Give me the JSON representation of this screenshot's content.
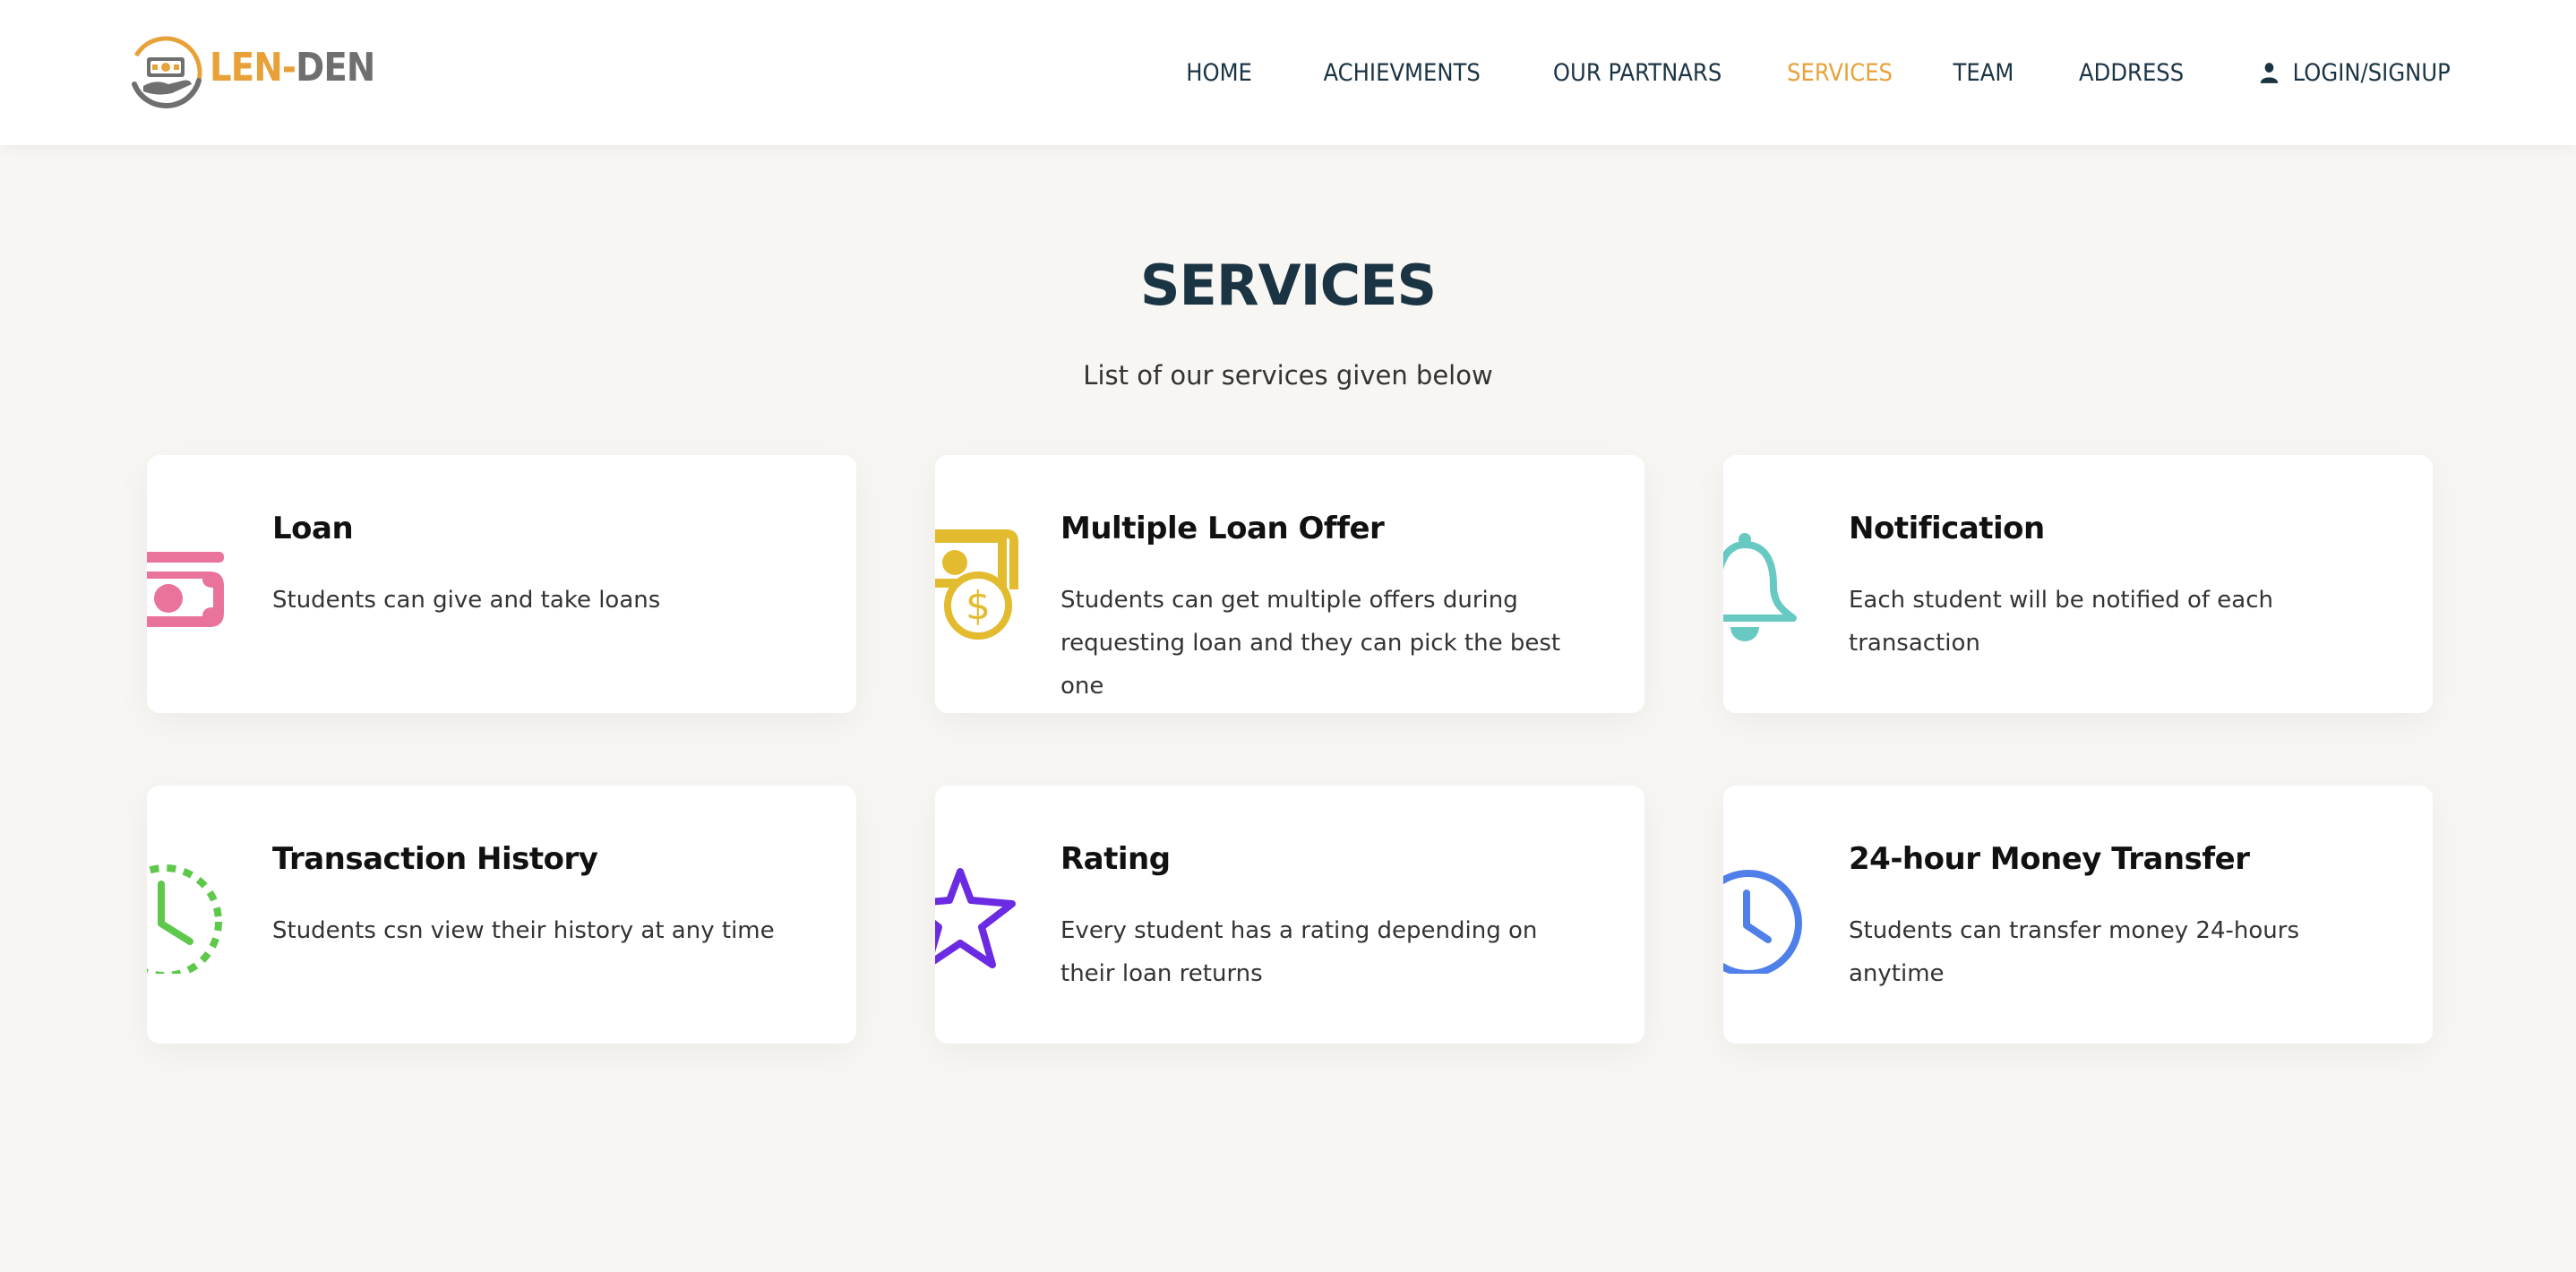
{
  "header": {
    "logo": {
      "part1": "LEN-",
      "part2": "DEN"
    },
    "nav": [
      {
        "label": "HOME"
      },
      {
        "label": "ACHIEVMENTS"
      },
      {
        "label": "OUR PARTNARS"
      },
      {
        "label": "SERVICES",
        "active": true
      },
      {
        "label": "TEAM"
      },
      {
        "label": "ADDRESS"
      }
    ],
    "login": {
      "label": "LOGIN/SIGNUP",
      "icon": "user-icon"
    }
  },
  "services": {
    "title": "SERVICES",
    "subtitle": "List of our services given below",
    "cards": [
      {
        "title": "Loan",
        "desc": "Students can give and take loans",
        "icon": "money-bill-icon",
        "color": "#e9739b"
      },
      {
        "title": "Multiple Loan Offer",
        "desc": "Students can get multiple offers during requesting loan and they can pick the best one",
        "icon": "coin-offer-icon",
        "color": "#e3bb2e"
      },
      {
        "title": "Notification",
        "desc": "Each student will be notified of each transaction",
        "icon": "bell-icon",
        "color": "#67c9c2"
      },
      {
        "title": "Transaction History",
        "desc": "Students csn view their history at any time",
        "icon": "history-clock-icon",
        "color": "#5dc84a"
      },
      {
        "title": "Rating",
        "desc": "Every student has a rating depending on their loan returns",
        "icon": "star-icon",
        "color": "#6a2be2"
      },
      {
        "title": "24-hour Money Transfer",
        "desc": "Students can transfer money 24-hours anytime",
        "icon": "clock-icon",
        "color": "#4f7fe8"
      }
    ]
  },
  "colors": {
    "accent": "#e8a139",
    "navy": "#1b3444",
    "background": "#f8f6f2"
  }
}
